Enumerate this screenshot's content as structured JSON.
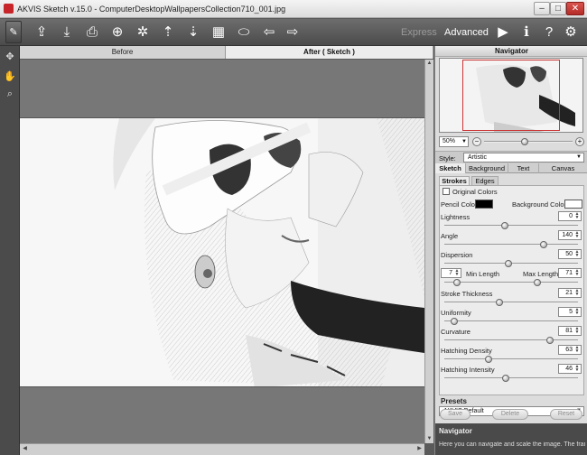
{
  "window": {
    "title": "AKVIS Sketch v.15.0 - ComputerDesktopWallpapersCollection710_001.jpg"
  },
  "toolbar": {
    "icons": [
      "brush-icon",
      "open-icon",
      "save-icon",
      "print-icon",
      "share-icon",
      "batch-icon",
      "import-icon",
      "export-icon",
      "film-icon",
      "eraser-icon",
      "undo-icon",
      "redo-icon"
    ],
    "express_label": "Express",
    "advanced_label": "Advanced",
    "run_icon": "play-icon",
    "info_icon": "info-icon",
    "help_icon": "help-icon",
    "settings_icon": "gear-icon"
  },
  "view_tabs": {
    "before": "Before",
    "after": "After ( Sketch )"
  },
  "navigator": {
    "title": "Navigator",
    "zoom": "50%",
    "zoom_level": 0.45
  },
  "style": {
    "label": "Style:",
    "value": "Artistic"
  },
  "panel_tabs": [
    "Sketch",
    "Background",
    "Text",
    "Canvas"
  ],
  "sub_tabs": [
    "Strokes",
    "Edges"
  ],
  "strokes": {
    "original_colors": "Original Colors",
    "pencil_color_label": "Pencil Color",
    "pencil_color": "#000000",
    "background_color_label": "Background Color",
    "background_color": "#ffffff",
    "lightness": {
      "label": "Lightness",
      "value": "0",
      "level": 0.45
    },
    "angle": {
      "label": "Angle",
      "value": "140",
      "level": 0.76
    },
    "dispersion": {
      "label": "Dispersion",
      "value": "50",
      "level": 0.48
    },
    "min_length": {
      "label": "Min Length",
      "value": "7",
      "level": 0.07
    },
    "max_length": {
      "label": "Max Length",
      "value": "71",
      "level": 0.71
    },
    "stroke_thickness": {
      "label": "Stroke Thickness",
      "value": "21",
      "level": 0.41
    },
    "uniformity": {
      "label": "Uniformity",
      "value": "5",
      "level": 0.05
    },
    "curvature": {
      "label": "Curvature",
      "value": "81",
      "level": 0.81
    },
    "hatching_density": {
      "label": "Hatching Density",
      "value": "63",
      "level": 0.32
    },
    "hatching_intensity": {
      "label": "Hatching Intensity",
      "value": "46",
      "level": 0.46
    }
  },
  "presets": {
    "title": "Presets",
    "value": "AKVIS Default",
    "save": "Save",
    "delete": "Delete",
    "reset": "Reset"
  },
  "help": {
    "title": "Navigator",
    "text": "Here you can navigate and scale the image. The frame shows the part of the image that is now"
  }
}
